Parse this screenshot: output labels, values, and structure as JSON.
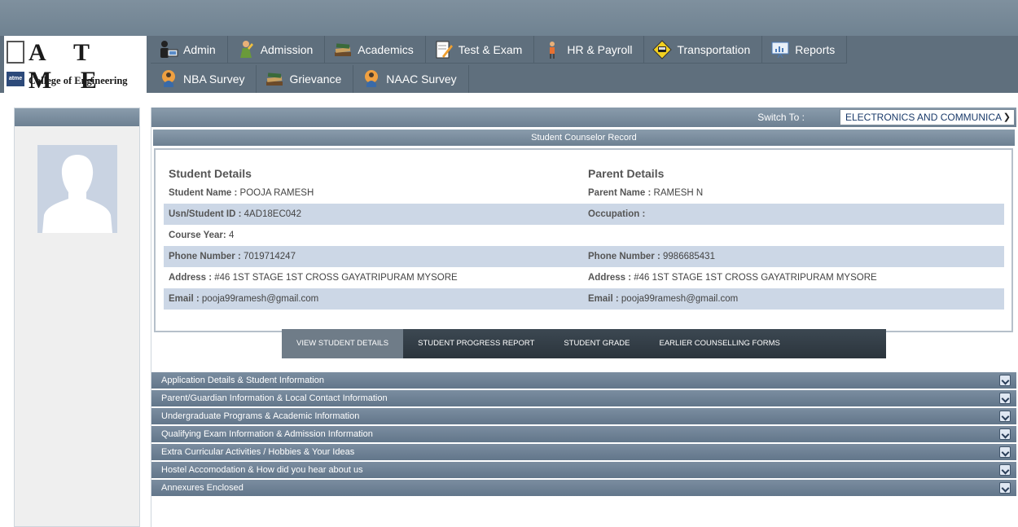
{
  "logo": {
    "letters": "A T M E",
    "badge": "atme",
    "college": "College of Engineering"
  },
  "menu": {
    "row1": [
      {
        "label": "Admin",
        "icon": "admin-user-icon"
      },
      {
        "label": "Admission",
        "icon": "admission-person-icon"
      },
      {
        "label": "Academics",
        "icon": "books-icon"
      },
      {
        "label": "Test & Exam",
        "icon": "notepad-pencil-icon"
      },
      {
        "label": "HR & Payroll",
        "icon": "worker-icon"
      },
      {
        "label": "Transportation",
        "icon": "bus-sign-icon"
      },
      {
        "label": "Reports",
        "icon": "presentation-chart-icon"
      }
    ],
    "row2": [
      {
        "label": "NBA Survey",
        "icon": "survey-person-icon"
      },
      {
        "label": "Grievance",
        "icon": "books-icon"
      },
      {
        "label": "NAAC Survey",
        "icon": "survey-person-icon"
      }
    ]
  },
  "switch": {
    "label": "Switch To :",
    "selected": "ELECTRONICS AND COMMUNICA"
  },
  "record_title": "Student Counselor Record",
  "student": {
    "title": "Student Details",
    "rows": [
      {
        "label": "Student Name :",
        "value": " POOJA RAMESH"
      },
      {
        "label": "Usn/Student ID :",
        "value": " 4AD18EC042"
      },
      {
        "label": "Course Year:",
        "value": " 4"
      },
      {
        "label": "Phone Number :",
        "value": " 7019714247"
      },
      {
        "label": "Address :",
        "value": " #46 1ST STAGE 1ST CROSS GAYATRIPURAM MYSORE"
      },
      {
        "label": "Email :",
        "value": " pooja99ramesh@gmail.com"
      }
    ]
  },
  "parent": {
    "title": "Parent Details",
    "rows": [
      {
        "label": "Parent Name :",
        "value": " RAMESH N"
      },
      {
        "label": "Occupation :",
        "value": ""
      },
      {
        "label": "",
        "value": ""
      },
      {
        "label": "Phone Number :",
        "value": " 9986685431"
      },
      {
        "label": "Address :",
        "value": " #46 1ST STAGE 1ST CROSS GAYATRIPURAM MYSORE"
      },
      {
        "label": "Email :",
        "value": " pooja99ramesh@gmail.com"
      }
    ]
  },
  "tabs": [
    "VIEW STUDENT DETAILS",
    "STUDENT PROGRESS REPORT",
    "STUDENT GRADE",
    "EARLIER COUNSELLING FORMS"
  ],
  "accordion": [
    "Application Details & Student Information",
    "Parent/Guardian Information & Local Contact Information",
    "Undergraduate Programs & Academic Information",
    "Qualifying Exam Information & Admission Information",
    "Extra Curricular Activities / Hobbies & Your Ideas",
    "Hostel Accomodation & How did you hear about us",
    "Annexures Enclosed"
  ]
}
